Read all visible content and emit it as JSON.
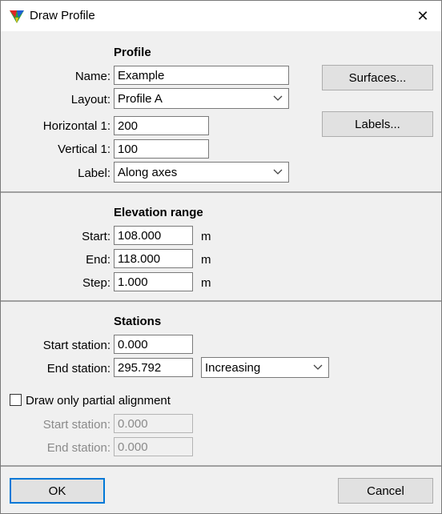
{
  "window": {
    "title": "Draw Profile",
    "close_glyph": "✕"
  },
  "profile": {
    "heading": "Profile",
    "name_label": "Name:",
    "name_value": "Example",
    "layout_label": "Layout:",
    "layout_value": "Profile A",
    "horizontal_label": "Horizontal 1:",
    "horizontal_value": "200",
    "vertical_label": "Vertical 1:",
    "vertical_value": "100",
    "label_label": "Label:",
    "label_value": "Along axes",
    "surfaces_button": "Surfaces...",
    "labels_button": "Labels..."
  },
  "elevation": {
    "heading": "Elevation range",
    "start_label": "Start:",
    "start_value": "108.000",
    "start_unit": "m",
    "end_label": "End:",
    "end_value": "118.000",
    "end_unit": "m",
    "step_label": "Step:",
    "step_value": "1.000",
    "step_unit": "m"
  },
  "stations": {
    "heading": "Stations",
    "start_label": "Start station:",
    "start_value": "0.000",
    "end_label": "End station:",
    "end_value": "295.792",
    "direction_value": "Increasing",
    "partial_label": "Draw only partial alignment",
    "partial_checked": false,
    "partial_start_label": "Start station:",
    "partial_start_value": "0.000",
    "partial_end_label": "End station:",
    "partial_end_value": "0.000"
  },
  "footer": {
    "ok_button": "OK",
    "cancel_button": "Cancel"
  },
  "icons": {
    "app": "terrasolid-app-icon",
    "chevron": "chevron-down-icon",
    "close": "close-icon"
  },
  "colors": {
    "default_button_border": "#0078d7",
    "dialog_bg": "#f0f0f0"
  }
}
